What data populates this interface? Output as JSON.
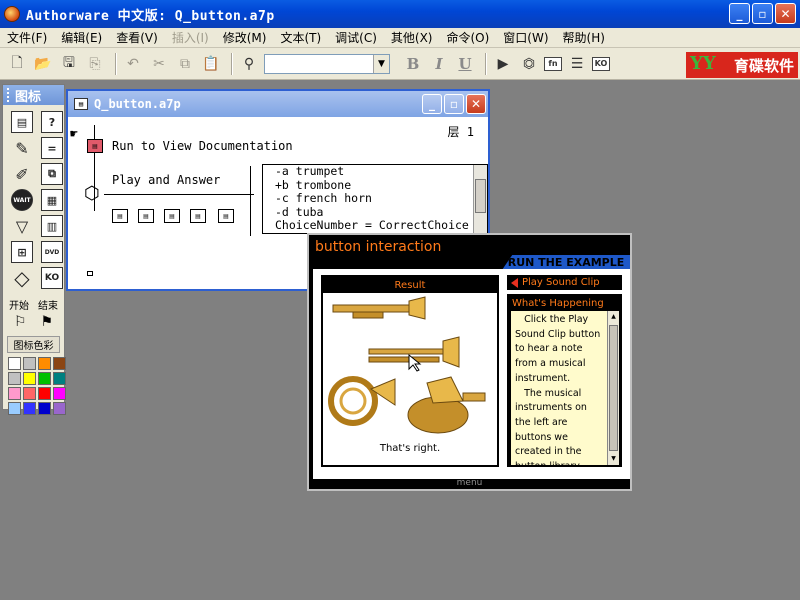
{
  "app": {
    "title": "Authorware 中文版: Q_button.a7p",
    "window_buttons": [
      "_",
      "▫",
      "✕"
    ]
  },
  "menu": [
    "文件(F)",
    "编辑(E)",
    "查看(V)",
    "插入(I)",
    "修改(M)",
    "文本(T)",
    "调试(C)",
    "其他(X)",
    "命令(O)",
    "窗口(W)",
    "帮助(H)"
  ],
  "toolbar": {
    "bold": "B",
    "italic": "I",
    "underline": "U",
    "ko_label": "KO",
    "fn_label": "fn",
    "brand": "育碟软件",
    "brand_mark": "YY"
  },
  "palette": {
    "title": "图标",
    "icons": [
      {
        "name": "display-icon",
        "glyph": "▤"
      },
      {
        "name": "motion-icon",
        "glyph": "?"
      },
      {
        "name": "erase-icon",
        "glyph": "✎"
      },
      {
        "name": "calc-icon",
        "glyph": "="
      },
      {
        "name": "edit-icon",
        "glyph": "✐"
      },
      {
        "name": "map-icon",
        "glyph": "⧉"
      },
      {
        "name": "wait-icon",
        "glyph": "WAIT"
      },
      {
        "name": "navigate-icon",
        "glyph": "▦"
      },
      {
        "name": "decision-icon",
        "glyph": "▽"
      },
      {
        "name": "movie-icon",
        "glyph": "▥"
      },
      {
        "name": "framework-icon",
        "glyph": "⊞"
      },
      {
        "name": "sound-icon",
        "glyph": "DVD"
      },
      {
        "name": "interaction-icon",
        "glyph": "◇"
      },
      {
        "name": "ko-icon",
        "glyph": "KO"
      }
    ],
    "start_label": "开始",
    "end_label": "结束",
    "color_title": "图标色彩",
    "colors": [
      "#ffffff",
      "#c0c0c0",
      "#ff8c00",
      "#8b4513",
      "#c0c0c0",
      "#ffff00",
      "#00c000",
      "#008080",
      "#ff99cc",
      "#ff6666",
      "#ff0000",
      "#ff00ff",
      "#99ccff",
      "#3333ff",
      "#0000cc",
      "#9966cc"
    ]
  },
  "design_window": {
    "title": "Q_button.a7p",
    "layer": "层 1",
    "flow": {
      "icon1_label": "Run to View Documentation",
      "interaction_label": "Play and Answer"
    },
    "responses": [
      "-a trumpet",
      "+b trombone",
      "-c french horn",
      "-d tuba",
      "ChoiceNumber = CorrectChoice"
    ]
  },
  "presentation": {
    "title": "button interaction",
    "run_label": "RUN THE EXAMPLE",
    "result_header": "Result",
    "result_caption": "That's right.",
    "play_label": "Play Sound Clip",
    "whats_header": "What's Happening",
    "whats_text": "   Click the Play Sound Clip button to hear a note from a musical instrument.\n   The musical instruments on the left are buttons we created in the button library.",
    "menu_label": "menu"
  }
}
